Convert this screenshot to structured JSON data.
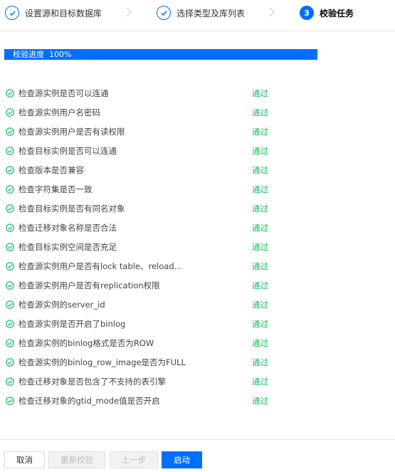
{
  "steps": [
    {
      "label": "设置源和目标数据库",
      "state": "done"
    },
    {
      "label": "选择类型及库列表",
      "state": "done"
    },
    {
      "label": "校验任务",
      "state": "active",
      "number": "3"
    }
  ],
  "progress": {
    "label": "校验进度",
    "value_text": "100%",
    "fraction": 1.0
  },
  "checks": [
    {
      "name": "检查源实例是否可以连通",
      "status": "通过"
    },
    {
      "name": "检查源实例用户名密码",
      "status": "通过"
    },
    {
      "name": "检查源实例用户是否有读权限",
      "status": "通过"
    },
    {
      "name": "检查目标实例是否可以连通",
      "status": "通过"
    },
    {
      "name": "检查版本是否兼容",
      "status": "通过"
    },
    {
      "name": "检查字符集是否一致",
      "status": "通过"
    },
    {
      "name": "检查目标实例是否有同名对象",
      "status": "通过"
    },
    {
      "name": "检查迁移对象名称是否合法",
      "status": "通过"
    },
    {
      "name": "检查目标实例空间是否充足",
      "status": "通过"
    },
    {
      "name": "检查源实例用户是否有lock table、reload…",
      "status": "通过"
    },
    {
      "name": "检查源实例用户是否有replication权限",
      "status": "通过"
    },
    {
      "name": "检查源实例的server_id",
      "status": "通过"
    },
    {
      "name": "检查源实例是否开启了binlog",
      "status": "通过"
    },
    {
      "name": "检查源实例的binlog格式是否为ROW",
      "status": "通过"
    },
    {
      "name": "检查源实例的binlog_row_image是否为FULL",
      "status": "通过"
    },
    {
      "name": "检查迁移对象是否包含了不支持的表引擎",
      "status": "通过"
    },
    {
      "name": "检查迁移对象的gtid_mode值是否开启",
      "status": "通过"
    }
  ],
  "buttons": {
    "cancel": "取消",
    "recheck": "重新校验",
    "prev": "上一步",
    "start": "启动"
  },
  "colors": {
    "accent": "#006eff",
    "success": "#0abf5b"
  },
  "icons": {
    "step_done": "check-circle-icon",
    "step_separator": "chevron-right-icon",
    "check_ok": "check-circle-icon"
  }
}
